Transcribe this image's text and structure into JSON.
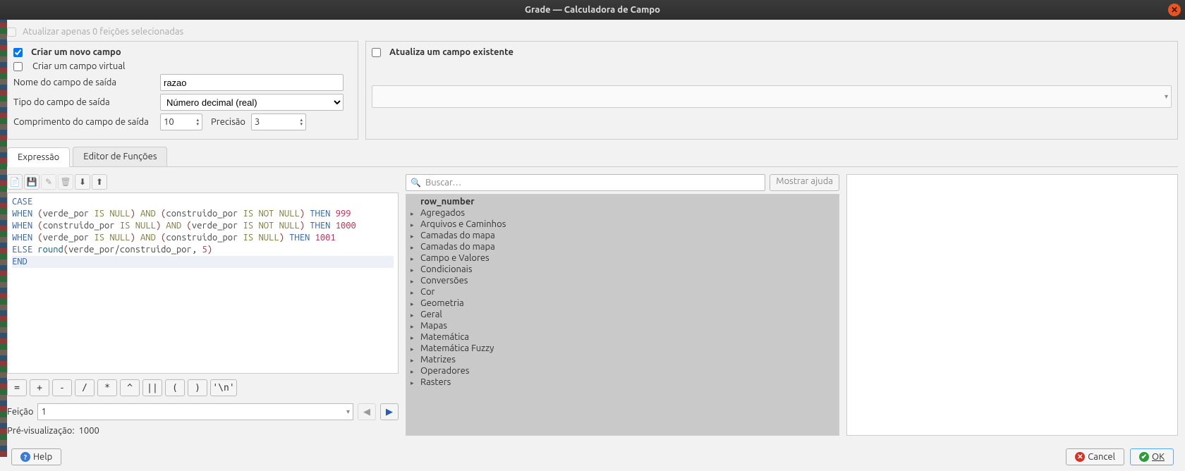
{
  "title": "Grade — Calculadora de Campo",
  "top_disabled_check": "Atualizar apenas 0 feições selecionadas",
  "left_panel": {
    "header_label": "Criar um novo campo",
    "virtual_label": "Criar um campo virtual",
    "name_label": "Nome do campo de saída",
    "name_value": "razao",
    "type_label": "Tipo do campo de saída",
    "type_value": "Número decimal (real)",
    "length_label": "Comprimento do campo de saída",
    "length_value": "10",
    "precision_label": "Precisão",
    "precision_value": "3"
  },
  "right_panel": {
    "header_label": "Atualiza um campo existente"
  },
  "tabs": {
    "expr": "Expressão",
    "funcs": "Editor de Funções"
  },
  "toolbar_icons": {
    "new": "new-file-icon",
    "save": "save-icon",
    "edit": "edit-icon",
    "delete": "delete-icon",
    "download": "download-icon",
    "upload": "upload-icon"
  },
  "expression": {
    "l1_case": "CASE",
    "l2_when": "WHEN",
    "l2_a": "(verde_por ",
    "l2_isnull": "IS NULL",
    "l2_b": ") ",
    "l2_and": "AND",
    "l2_c": " (construido_por ",
    "l2_notnull": "IS NOT NULL",
    "l2_d": ") ",
    "l2_then": "THEN",
    "l2_num": " 999",
    "l3_when": "WHEN",
    "l3_a": "(construido_por ",
    "l3_isnull": "IS NULL",
    "l3_b": ") ",
    "l3_and": "AND",
    "l3_c": " (verde_por ",
    "l3_notnull": "IS NOT NULL",
    "l3_d": ") ",
    "l3_then": "THEN",
    "l3_num": " 1000",
    "l4_when": "WHEN",
    "l4_a": "(verde_por ",
    "l4_isnull": "IS NULL",
    "l4_b": ") ",
    "l4_and": "AND",
    "l4_c": " (construido_por ",
    "l4_isnull2": "IS NULL",
    "l4_d": ") ",
    "l4_then": "THEN",
    "l4_num": " 1001",
    "l5_else": "ELSE",
    "l5_fn": " round",
    "l5_args": "(verde_por/construido_por, ",
    "l5_num": "5",
    "l5_close": ")",
    "l6_end": "END"
  },
  "op_buttons": [
    "=",
    "+",
    "-",
    "/",
    "*",
    "^",
    "||",
    "(",
    ")",
    "'\\n'"
  ],
  "feicao": {
    "label": "Feição",
    "value": "1"
  },
  "preview": {
    "label": "Pré-visualização:",
    "value": "1000"
  },
  "search_placeholder": "Buscar…",
  "show_help": "Mostrar ajuda",
  "tree_bold": "row_number",
  "tree_items": [
    "Agregados",
    "Arquivos e Caminhos",
    "Camadas do mapa",
    "Camadas do mapa",
    "Campo e Valores",
    "Condicionais",
    "Conversões",
    "Cor",
    "Geometria",
    "Geral",
    "Mapas",
    "Matemática",
    "Matemática Fuzzy",
    "Matrizes",
    "Operadores",
    "Rasters"
  ],
  "footer": {
    "help": "Help",
    "cancel": "Cancel",
    "ok": "OK"
  }
}
